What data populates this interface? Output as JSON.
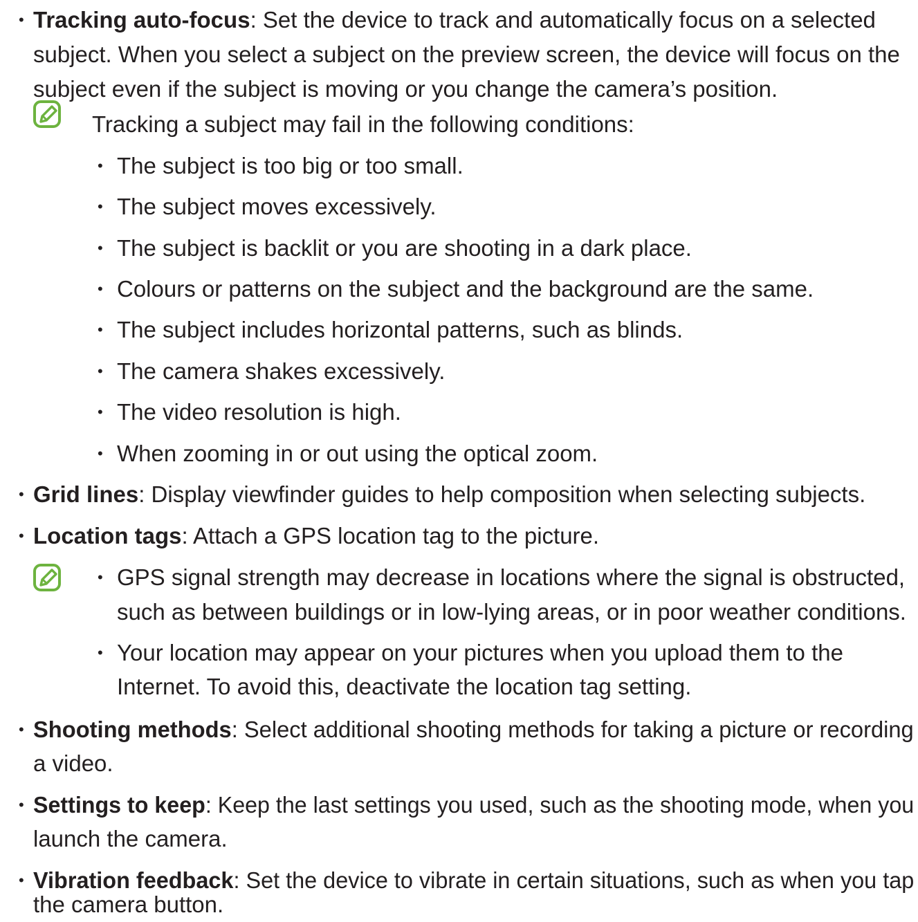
{
  "accent_color": "#6db33f",
  "items": [
    {
      "term": "Tracking auto-focus",
      "lines": [
        ": Set the device to track and automatically focus on a selected",
        "subject. When you select a subject on the preview screen, the device will focus on the",
        "subject even if the subject is moving or you change the camera’s position."
      ]
    },
    {
      "term": "Grid lines",
      "lines": [
        ": Display viewfinder guides to help composition when selecting subjects."
      ]
    },
    {
      "term": "Location tags",
      "lines": [
        ": Attach a GPS location tag to the picture."
      ]
    },
    {
      "term": "Shooting methods",
      "lines": [
        ": Select additional shooting methods for taking a picture or recording",
        "a video."
      ]
    },
    {
      "term": "Settings to keep",
      "lines": [
        ": Keep the last settings you used, such as the shooting mode, when you",
        "launch the camera."
      ]
    },
    {
      "term": "Vibration feedback",
      "lines": [
        ": Set the device to vibrate in certain situations, such as when you tap",
        "the camera button."
      ]
    }
  ],
  "note1": {
    "icon": "note-pencil-icon",
    "intro": "Tracking a subject may fail in the following conditions:",
    "conditions": [
      "The subject is too big or too small.",
      "The subject moves excessively.",
      "The subject is backlit or you are shooting in a dark place.",
      "Colours or patterns on the subject and the background are the same.",
      "The subject includes horizontal patterns, such as blinds.",
      "The camera shakes excessively.",
      "The video resolution is high.",
      "When zooming in or out using the optical zoom."
    ]
  },
  "note2": {
    "icon": "note-pencil-icon",
    "bullets": [
      {
        "lines": [
          "GPS signal strength may decrease in locations where the signal is obstructed,",
          "such as between buildings or in low-lying areas, or in poor weather conditions."
        ]
      },
      {
        "lines": [
          "Your location may appear on your pictures when you upload them to the",
          "Internet. To avoid this, deactivate the location tag setting."
        ]
      }
    ]
  }
}
